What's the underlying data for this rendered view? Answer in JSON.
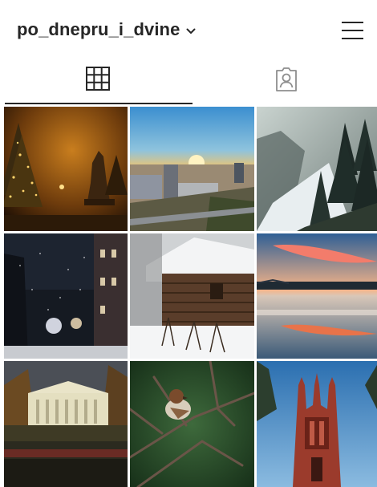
{
  "header": {
    "username": "po_dnepru_i_dvine",
    "username_dropdown_icon": "chevron-down-icon",
    "menu_icon": "hamburger-menu-icon"
  },
  "tabs": [
    {
      "name": "posts-grid",
      "icon": "grid-icon",
      "active": true
    },
    {
      "name": "tagged",
      "icon": "tagged-user-icon",
      "active": false
    }
  ],
  "posts": [
    {
      "subject": "night-monument-fir-trees"
    },
    {
      "subject": "city-sunset-aerial"
    },
    {
      "subject": "misty-pine-forest-river"
    },
    {
      "subject": "snowy-night-street"
    },
    {
      "subject": "snowy-wooden-cabin"
    },
    {
      "subject": "river-sunset-bridge"
    },
    {
      "subject": "theater-building-columns"
    },
    {
      "subject": "sparrow-on-branch"
    },
    {
      "subject": "red-brick-church-towers"
    }
  ],
  "colors": {
    "text": "#262626",
    "background": "#ffffff",
    "icon": "#262626"
  }
}
